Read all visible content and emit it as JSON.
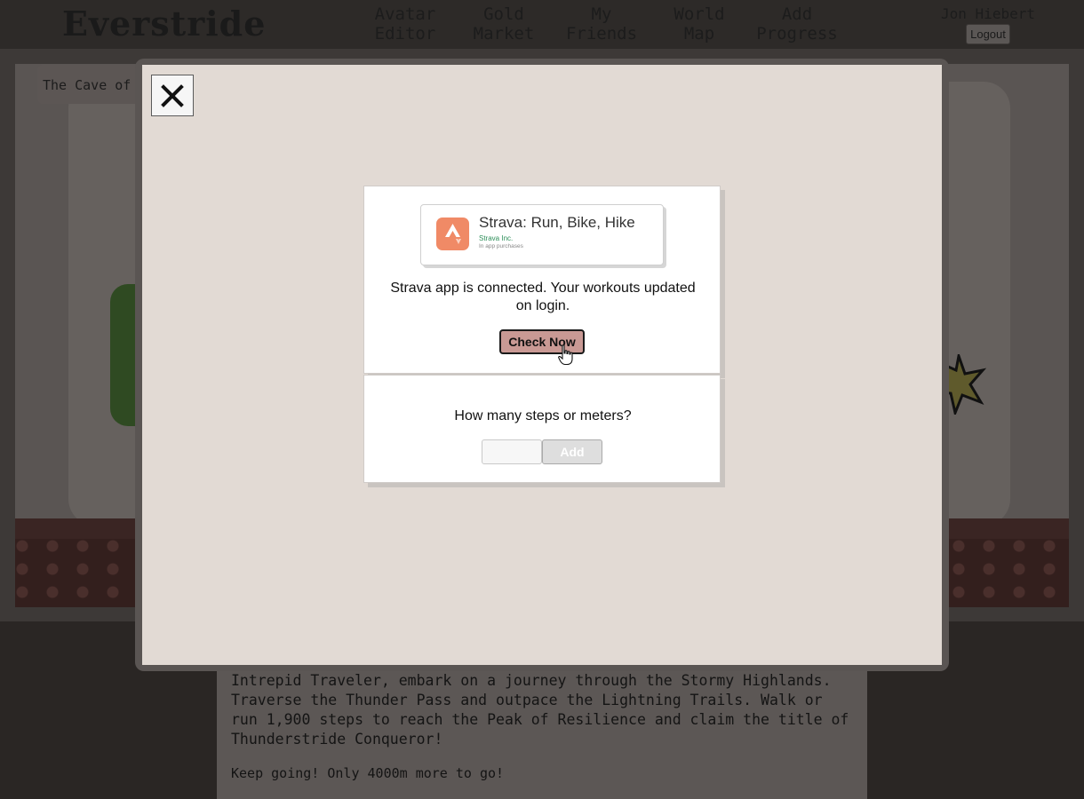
{
  "header": {
    "logo": "Everstride",
    "nav": [
      {
        "line1": "Avatar",
        "line2": "Editor"
      },
      {
        "line1": "Gold",
        "line2": "Market"
      },
      {
        "line1": "My",
        "line2": "Friends"
      },
      {
        "line1": "World",
        "line2": "Map"
      },
      {
        "line1": "Add",
        "line2": "Progress"
      }
    ],
    "user_name": "Jon Hiebert",
    "logout_label": "Logout"
  },
  "scene": {
    "location_title": "The Cave of t"
  },
  "story": {
    "text": "Intrepid Traveler, embark on a journey through the Stormy Highlands. Traverse the Thunder Pass and outpace the Lightning Trails. Walk or run 1,900 steps to reach the Peak of Resilience and claim the title of Thunderstride Conqueror!",
    "progress": "Keep going! Only 4000m more to go!"
  },
  "modal": {
    "close_glyph": "✕",
    "strava": {
      "app_name": "Strava: Run, Bike, Hike",
      "developer": "Strava Inc.",
      "purchases": "In app purchases",
      "status": "Strava app is connected. Your workouts updated on login.",
      "check_label": "Check Now"
    },
    "manual": {
      "prompt": "How many steps or meters?",
      "input_value": "",
      "add_label": "Add"
    }
  },
  "colors": {
    "accent_button": "#c99994",
    "strava_orange": "#f08a66",
    "modal_background": "#e2dad4"
  }
}
